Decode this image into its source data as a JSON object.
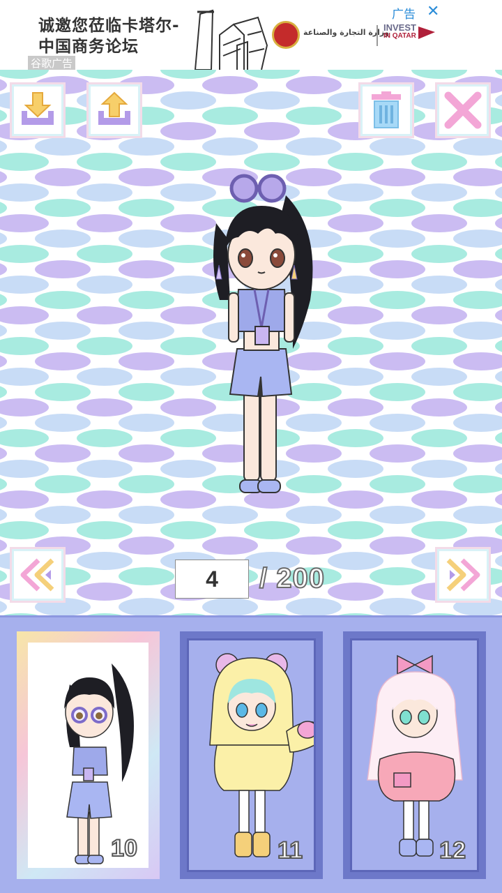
{
  "ad": {
    "headline": "诚邀您莅临卡塔尔-中国商务论坛",
    "google_label": "谷歌广告",
    "ad_tag": "广告",
    "close_symbol": "✕",
    "ministry_text": "وزارة التجارة والصناعة",
    "brand_line1": "INVEST",
    "brand_line2": "IN QATAR"
  },
  "toolbar": {
    "download_icon": "download-icon",
    "upload_icon": "upload-icon",
    "trash_icon": "trash-icon",
    "close_icon": "close-icon"
  },
  "pager": {
    "current": "4",
    "total": "/ 200",
    "prev_icon": "double-chevron-left-icon",
    "next_icon": "double-chevron-right-icon"
  },
  "cards": [
    {
      "number": "10",
      "selected": true
    },
    {
      "number": "11",
      "selected": false
    },
    {
      "number": "12",
      "selected": false
    }
  ],
  "colors": {
    "tray": "#a6b0ed",
    "wave_teal": "#a8ebe0",
    "wave_purple": "#cbbcf2",
    "wave_blue": "#c8dcf6",
    "accent_pink": "#f3a6d6",
    "accent_yellow": "#f5d07a"
  }
}
